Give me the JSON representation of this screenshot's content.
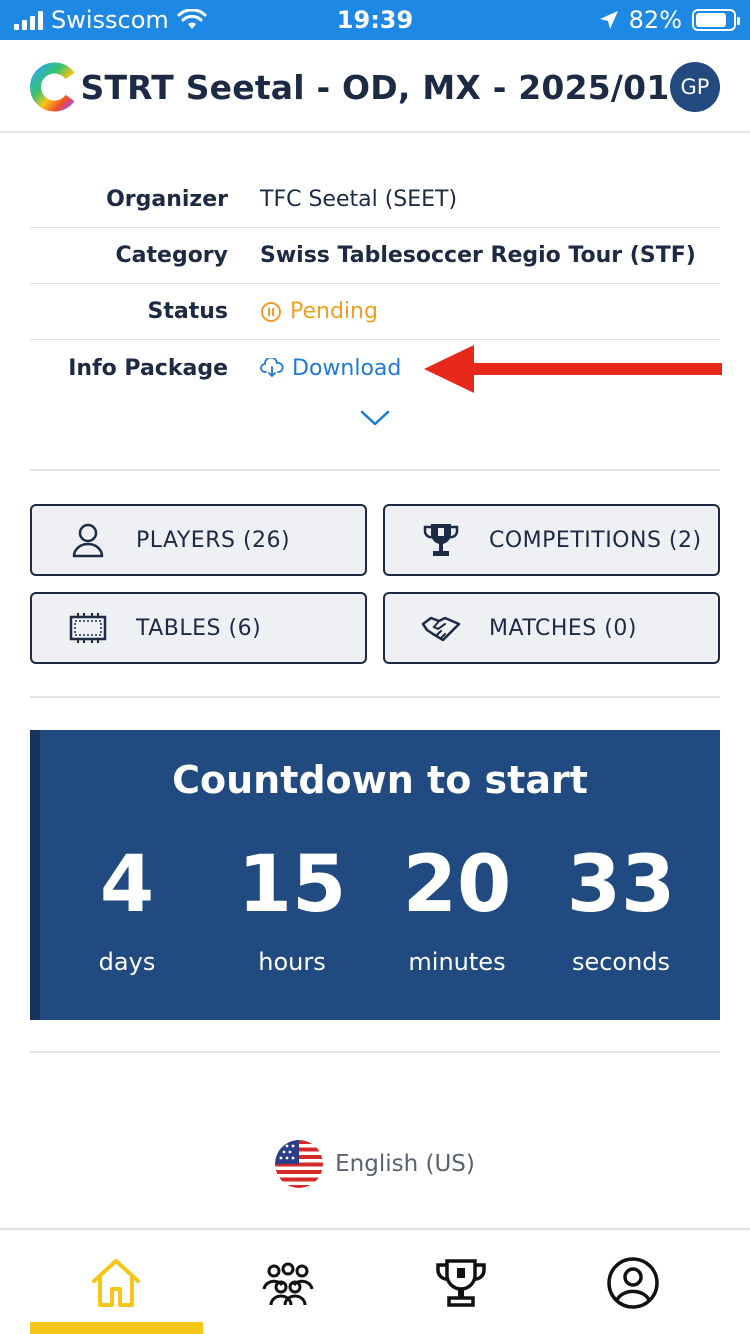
{
  "status_bar": {
    "carrier": "Swisscom",
    "time": "19:39",
    "battery": "82%",
    "battery_level": 0.82
  },
  "header": {
    "title": "STRT Seetal - OD, MX - 2025/01",
    "avatar_initials": "GP",
    "logo_icon": "colorful-c-logo"
  },
  "info": {
    "organizer_label": "Organizer",
    "organizer_value": "TFC Seetal (SEET)",
    "category_label": "Category",
    "category_value": "Swiss Tablesoccer Regio Tour (STF)",
    "status_label": "Status",
    "status_value": "Pending",
    "status_color": "#f0a020",
    "info_package_label": "Info Package",
    "info_package_link": "Download",
    "link_color": "#1e7ad6"
  },
  "annotation": {
    "arrow_color": "#e8281b"
  },
  "buttons": {
    "players": "PLAYERS (26)",
    "competitions": "COMPETITIONS (2)",
    "tables": "TABLES (6)",
    "matches": "MATCHES (0)"
  },
  "countdown": {
    "title": "Countdown to start",
    "days_value": "4",
    "days_label": "days",
    "hours_value": "15",
    "hours_label": "hours",
    "minutes_value": "20",
    "minutes_label": "minutes",
    "seconds_value": "33",
    "seconds_label": "seconds",
    "background_color": "#214b80"
  },
  "language": {
    "label": "English (US)",
    "flag_icon": "us-flag-icon"
  },
  "tabbar": {
    "active_color": "#f5c518",
    "items": [
      "home-icon",
      "players-group-icon",
      "trophy-icon",
      "account-icon"
    ]
  }
}
